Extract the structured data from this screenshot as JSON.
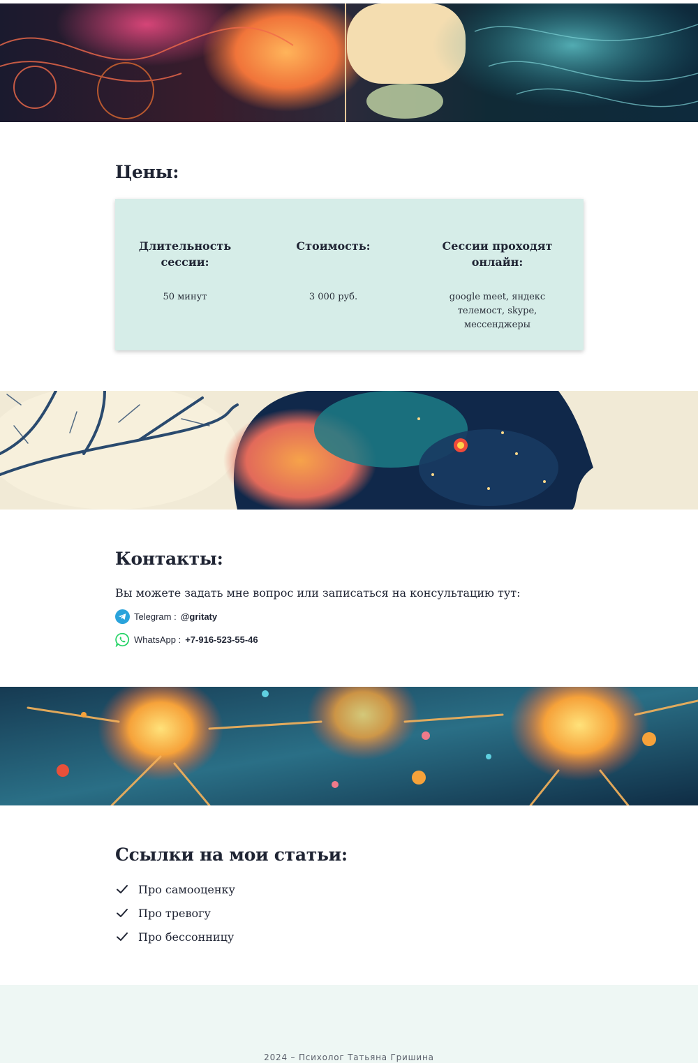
{
  "prices": {
    "title": "Цены:",
    "columns": [
      {
        "heading": "Длительность сессии:",
        "value": "50 минут"
      },
      {
        "heading": "Стоимость:",
        "value": "3 000 руб."
      },
      {
        "heading": "Сессии проходят онлайн:",
        "value": "google meet, яндекс телемост, skype, мессенджеры"
      }
    ]
  },
  "contacts": {
    "title": "Контакты:",
    "intro": "Вы можете задать мне вопрос или записаться на консультацию тут:",
    "telegram": {
      "label": "Telegram :",
      "value": "@gritaty",
      "icon": "telegram-icon"
    },
    "whatsapp": {
      "label": "WhatsApp :",
      "value": "+7-916-523-55-46",
      "icon": "whatsapp-icon"
    }
  },
  "articles": {
    "title": "Ссылки на мои статьи:",
    "items": [
      {
        "label": "Про самооценку",
        "icon": "checkmark-icon"
      },
      {
        "label": "Про тревогу",
        "icon": "checkmark-icon"
      },
      {
        "label": "Про бессонницу",
        "icon": "checkmark-icon"
      }
    ]
  },
  "footer": {
    "text": "2024 – Психолог Татьяна Гришина"
  },
  "colors": {
    "card_background": "#d6ede8",
    "footer_background": "#eef7f4",
    "text": "#1f2433",
    "telegram": "#2aa3db",
    "whatsapp": "#25d366"
  }
}
